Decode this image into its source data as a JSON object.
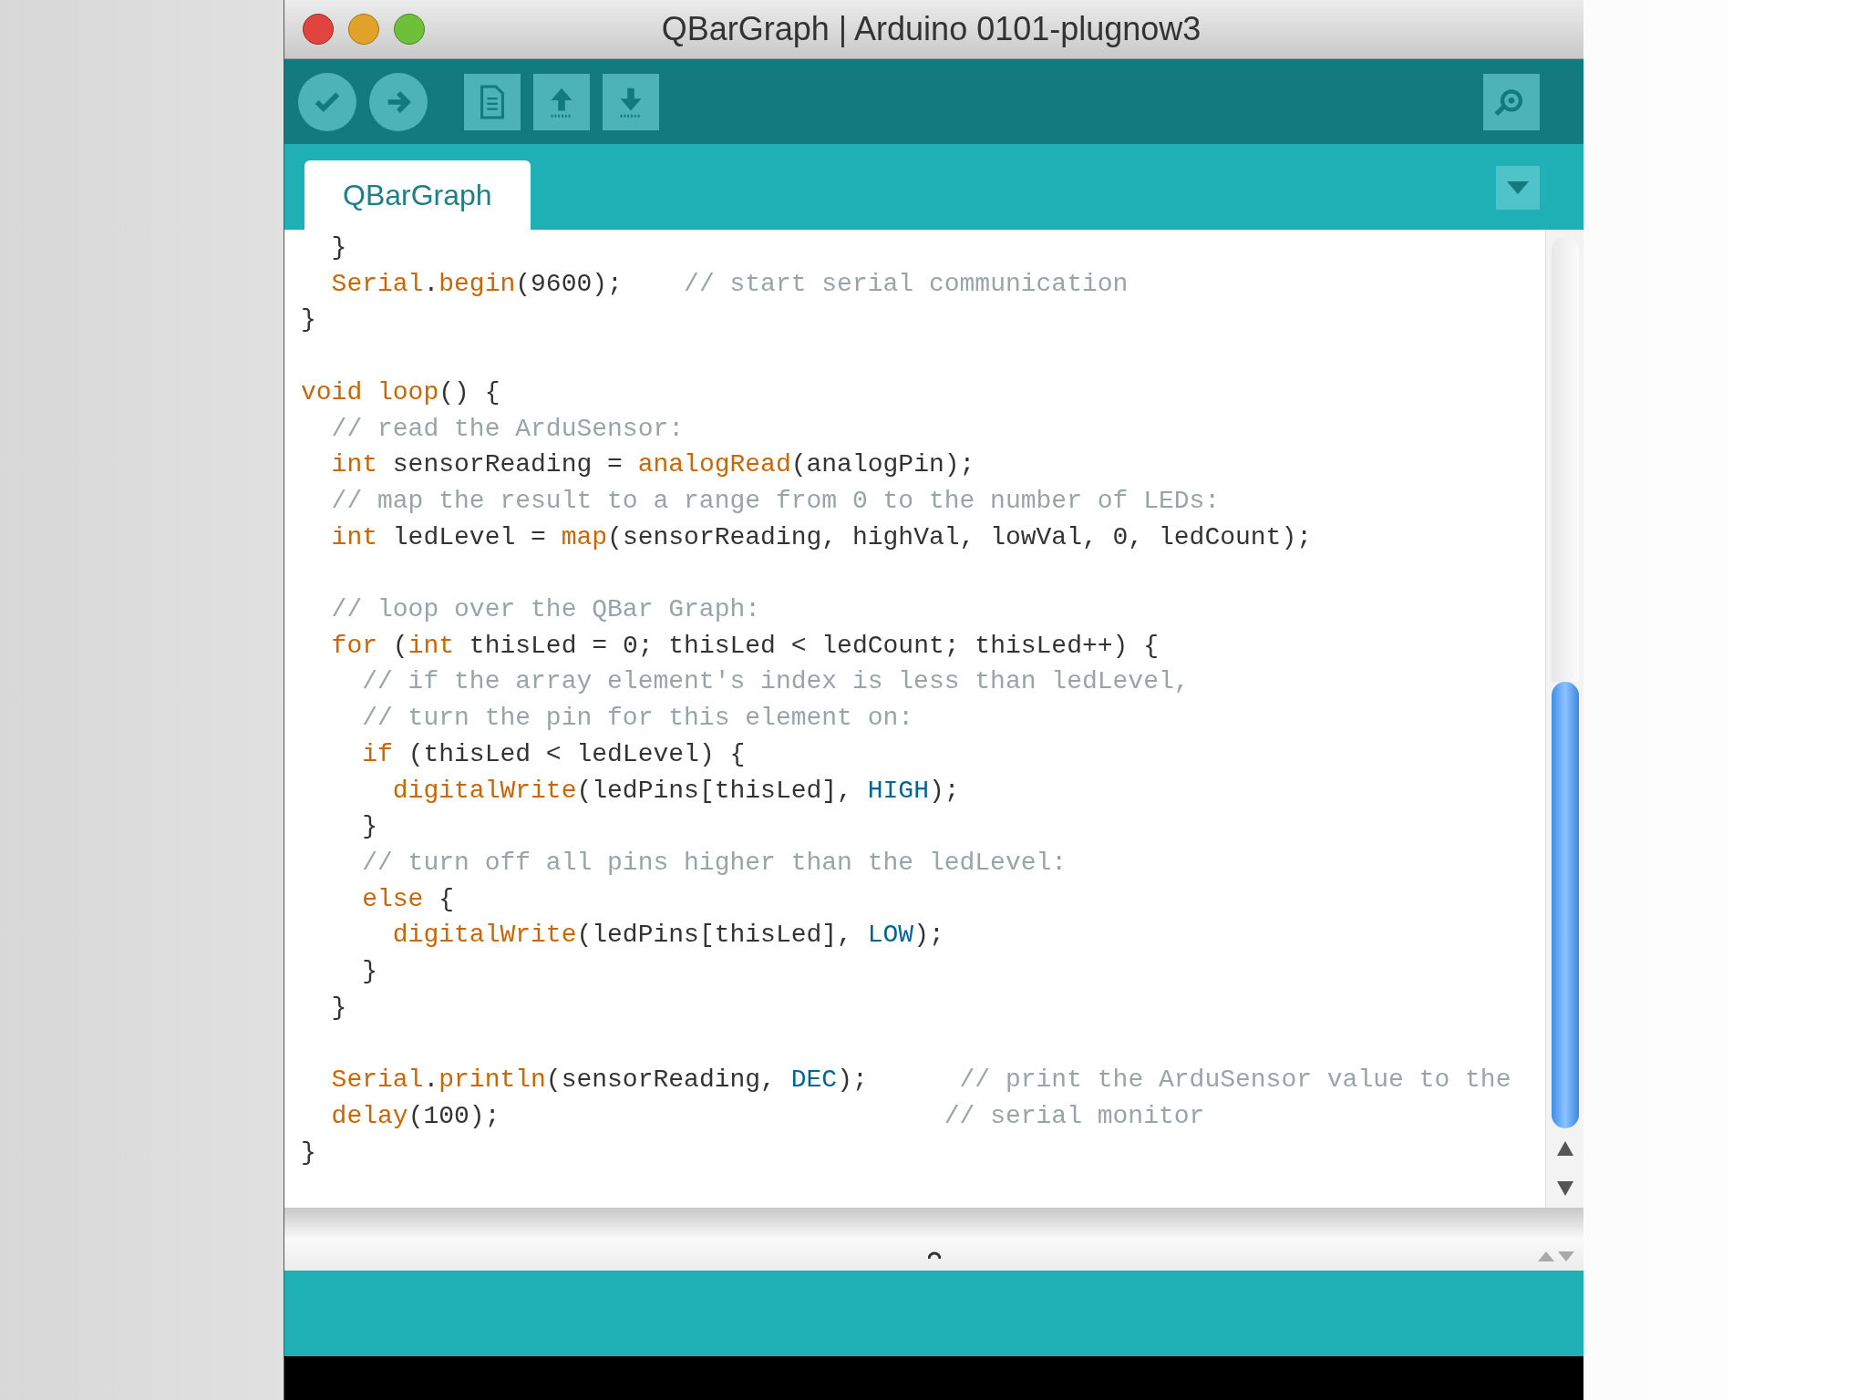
{
  "window": {
    "title": "QBarGraph | Arduino 0101-plugnow3"
  },
  "tabs": [
    {
      "label": "QBarGraph",
      "selected": true
    }
  ],
  "editor": {
    "lines": [
      {
        "kind": "code",
        "tokens": [
          {
            "kind": "plain",
            "text": "  }"
          }
        ]
      },
      {
        "kind": "code",
        "tokens": [
          {
            "kind": "keyword",
            "text": "  Serial"
          },
          {
            "kind": "plain",
            "text": "."
          },
          {
            "kind": "keyword",
            "text": "begin"
          },
          {
            "kind": "plain",
            "text": "(9600);    "
          },
          {
            "kind": "comment",
            "text": "// start serial communication"
          }
        ]
      },
      {
        "kind": "code",
        "tokens": [
          {
            "kind": "plain",
            "text": "}"
          }
        ]
      },
      {
        "kind": "blank"
      },
      {
        "kind": "code",
        "tokens": [
          {
            "kind": "keyword",
            "text": "void "
          },
          {
            "kind": "keyword",
            "text": "loop"
          },
          {
            "kind": "plain",
            "text": "() {"
          }
        ]
      },
      {
        "kind": "code",
        "tokens": [
          {
            "kind": "comment",
            "text": "  // read the ArduSensor:"
          }
        ]
      },
      {
        "kind": "code",
        "tokens": [
          {
            "kind": "keyword",
            "text": "  int"
          },
          {
            "kind": "plain",
            "text": " sensorReading = "
          },
          {
            "kind": "keyword",
            "text": "analogRead"
          },
          {
            "kind": "plain",
            "text": "(analogPin);"
          }
        ]
      },
      {
        "kind": "code",
        "tokens": [
          {
            "kind": "comment",
            "text": "  // map the result to a range from 0 to the number of LEDs:"
          }
        ]
      },
      {
        "kind": "code",
        "tokens": [
          {
            "kind": "keyword",
            "text": "  int"
          },
          {
            "kind": "plain",
            "text": " ledLevel = "
          },
          {
            "kind": "keyword",
            "text": "map"
          },
          {
            "kind": "plain",
            "text": "(sensorReading, highVal, lowVal, 0, ledCount);"
          }
        ]
      },
      {
        "kind": "blank"
      },
      {
        "kind": "code",
        "tokens": [
          {
            "kind": "comment",
            "text": "  // loop over the QBar Graph:"
          }
        ]
      },
      {
        "kind": "code",
        "tokens": [
          {
            "kind": "keyword",
            "text": "  for"
          },
          {
            "kind": "plain",
            "text": " ("
          },
          {
            "kind": "keyword",
            "text": "int"
          },
          {
            "kind": "plain",
            "text": " thisLed = 0; thisLed < ledCount; thisLed++) {"
          }
        ]
      },
      {
        "kind": "code",
        "tokens": [
          {
            "kind": "comment",
            "text": "    // if the array element's index is less than ledLevel,"
          }
        ]
      },
      {
        "kind": "code",
        "tokens": [
          {
            "kind": "comment",
            "text": "    // turn the pin for this element on:"
          }
        ]
      },
      {
        "kind": "code",
        "tokens": [
          {
            "kind": "keyword",
            "text": "    if"
          },
          {
            "kind": "plain",
            "text": " (thisLed < ledLevel) {"
          }
        ]
      },
      {
        "kind": "code",
        "tokens": [
          {
            "kind": "keyword",
            "text": "      digitalWrite"
          },
          {
            "kind": "plain",
            "text": "(ledPins[thisLed], "
          },
          {
            "kind": "constant",
            "text": "HIGH"
          },
          {
            "kind": "plain",
            "text": ");"
          }
        ]
      },
      {
        "kind": "code",
        "tokens": [
          {
            "kind": "plain",
            "text": "    }"
          }
        ]
      },
      {
        "kind": "code",
        "tokens": [
          {
            "kind": "comment",
            "text": "    // turn off all pins higher than the ledLevel:"
          }
        ]
      },
      {
        "kind": "code",
        "tokens": [
          {
            "kind": "keyword",
            "text": "    else"
          },
          {
            "kind": "plain",
            "text": " {"
          }
        ]
      },
      {
        "kind": "code",
        "tokens": [
          {
            "kind": "keyword",
            "text": "      digitalWrite"
          },
          {
            "kind": "plain",
            "text": "(ledPins[thisLed], "
          },
          {
            "kind": "constant",
            "text": "LOW"
          },
          {
            "kind": "plain",
            "text": ");"
          }
        ]
      },
      {
        "kind": "code",
        "tokens": [
          {
            "kind": "plain",
            "text": "    }"
          }
        ]
      },
      {
        "kind": "code",
        "tokens": [
          {
            "kind": "plain",
            "text": "  }"
          }
        ]
      },
      {
        "kind": "blank"
      },
      {
        "kind": "code",
        "tokens": [
          {
            "kind": "keyword",
            "text": "  Serial"
          },
          {
            "kind": "plain",
            "text": "."
          },
          {
            "kind": "keyword",
            "text": "println"
          },
          {
            "kind": "plain",
            "text": "(sensorReading, "
          },
          {
            "kind": "constant",
            "text": "DEC"
          },
          {
            "kind": "plain",
            "text": ");      "
          },
          {
            "kind": "comment",
            "text": "// print the ArduSensor value to the"
          }
        ]
      },
      {
        "kind": "code",
        "tokens": [
          {
            "kind": "keyword",
            "text": "  delay"
          },
          {
            "kind": "plain",
            "text": "(100);                             "
          },
          {
            "kind": "comment",
            "text": "// serial monitor"
          }
        ]
      },
      {
        "kind": "code",
        "tokens": [
          {
            "kind": "plain",
            "text": "}"
          }
        ]
      }
    ]
  }
}
